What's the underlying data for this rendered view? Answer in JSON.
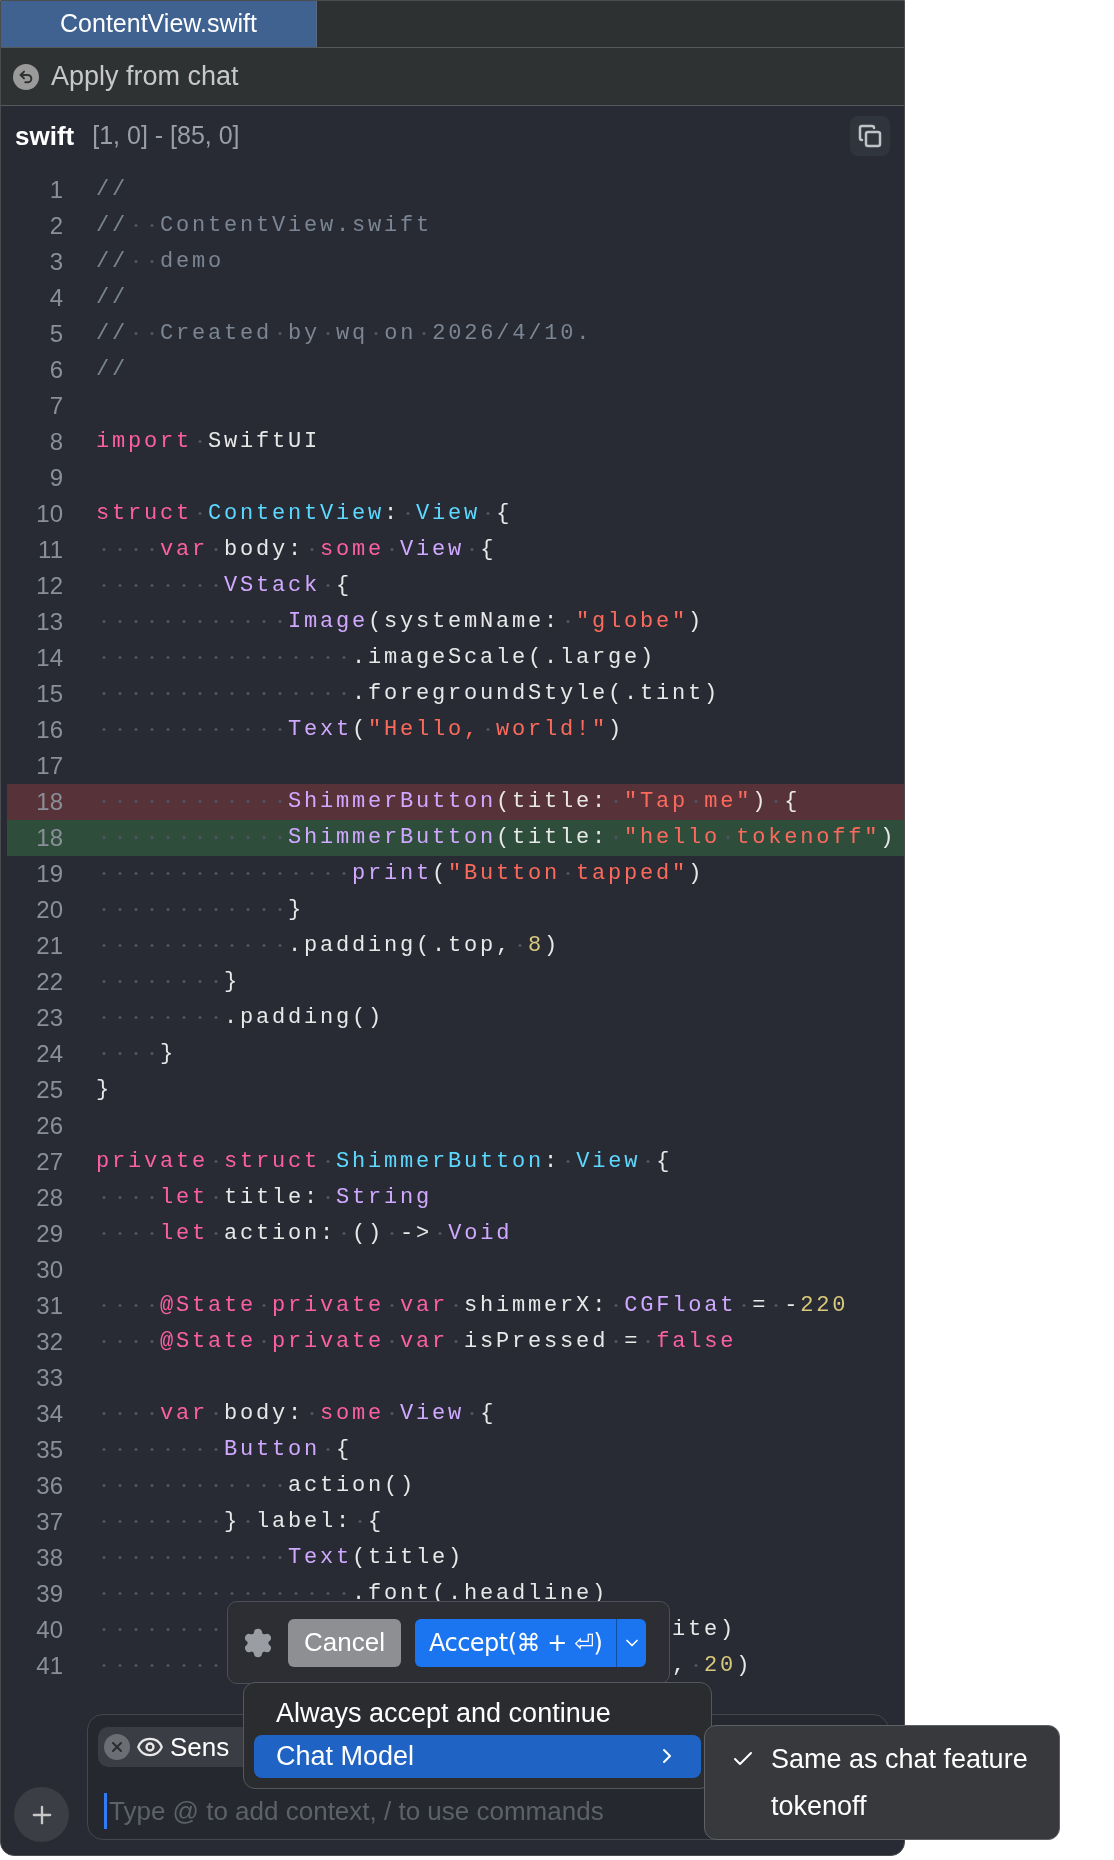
{
  "tabs": [
    {
      "label": "ContentView.swift",
      "selected": true
    }
  ],
  "apply_bar": {
    "label": "Apply from chat"
  },
  "code_header": {
    "language": "swift",
    "range": "[1, 0] - [85, 0]"
  },
  "lines": [
    {
      "number": "1",
      "kind": "context",
      "tokens": [
        {
          "kind": "comment",
          "text": "//"
        }
      ]
    },
    {
      "number": "2",
      "kind": "context",
      "tokens": [
        {
          "kind": "comment",
          "text": "//  ContentView.swift"
        }
      ]
    },
    {
      "number": "3",
      "kind": "context",
      "tokens": [
        {
          "kind": "comment",
          "text": "//  demo"
        }
      ]
    },
    {
      "number": "4",
      "kind": "context",
      "tokens": [
        {
          "kind": "comment",
          "text": "//"
        }
      ]
    },
    {
      "number": "5",
      "kind": "context",
      "tokens": [
        {
          "kind": "comment",
          "text": "//  Created by wq on 2026/4/10."
        }
      ]
    },
    {
      "number": "6",
      "kind": "context",
      "tokens": [
        {
          "kind": "comment",
          "text": "//"
        }
      ]
    },
    {
      "number": "7",
      "kind": "context"
    },
    {
      "number": "8",
      "kind": "context",
      "tokens": [
        {
          "kind": "keyword",
          "text": "import"
        },
        {
          "kind": "plain",
          "text": " SwiftUI"
        }
      ]
    },
    {
      "number": "9",
      "kind": "context"
    },
    {
      "number": "10",
      "kind": "context",
      "tokens": [
        {
          "kind": "keyword",
          "text": "struct"
        },
        {
          "kind": "type",
          "text": " ContentView"
        },
        {
          "kind": "plain",
          "text": ": "
        },
        {
          "kind": "type",
          "text": "View"
        },
        {
          "kind": "plain",
          "text": " {"
        }
      ]
    },
    {
      "number": "11",
      "kind": "context",
      "tokens": [
        {
          "kind": "keyword",
          "text": "    var"
        },
        {
          "kind": "plain",
          "text": " body: "
        },
        {
          "kind": "keyword",
          "text": "some"
        },
        {
          "kind": "call",
          "text": " View"
        },
        {
          "kind": "plain",
          "text": " {"
        }
      ]
    },
    {
      "number": "12",
      "kind": "context",
      "tokens": [
        {
          "kind": "call",
          "text": "        VStack"
        },
        {
          "kind": "plain",
          "text": " {"
        }
      ]
    },
    {
      "number": "13",
      "kind": "context",
      "tokens": [
        {
          "kind": "call",
          "text": "            Image"
        },
        {
          "kind": "plain",
          "text": "(systemName: "
        },
        {
          "kind": "string",
          "text": "\"globe\""
        },
        {
          "kind": "plain",
          "text": ")"
        }
      ]
    },
    {
      "number": "14",
      "kind": "context",
      "tokens": [
        {
          "kind": "plain",
          "text": "                .imageScale(.large)"
        }
      ]
    },
    {
      "number": "15",
      "kind": "context",
      "tokens": [
        {
          "kind": "plain",
          "text": "                .foregroundStyle(.tint)"
        }
      ]
    },
    {
      "number": "16",
      "kind": "context",
      "tokens": [
        {
          "kind": "call",
          "text": "            Text"
        },
        {
          "kind": "plain",
          "text": "("
        },
        {
          "kind": "string",
          "text": "\"Hello, world!\""
        },
        {
          "kind": "plain",
          "text": ")"
        }
      ]
    },
    {
      "number": "17",
      "kind": "context"
    },
    {
      "number": "18",
      "kind": "removed",
      "tokens": [
        {
          "kind": "call",
          "text": "            ShimmerButton"
        },
        {
          "kind": "plain",
          "text": "(title: "
        },
        {
          "kind": "string",
          "text": "\"Tap me\""
        },
        {
          "kind": "plain",
          "text": ") {"
        }
      ]
    },
    {
      "number": "18",
      "kind": "added",
      "tokens": [
        {
          "kind": "call",
          "text": "            ShimmerButton"
        },
        {
          "kind": "plain",
          "text": "(title: "
        },
        {
          "kind": "string",
          "text": "\"hello tokenoff\""
        },
        {
          "kind": "plain",
          "text": ")"
        }
      ]
    },
    {
      "number": "19",
      "kind": "context",
      "tokens": [
        {
          "kind": "call",
          "text": "                print"
        },
        {
          "kind": "plain",
          "text": "("
        },
        {
          "kind": "string",
          "text": "\"Button tapped\""
        },
        {
          "kind": "plain",
          "text": ")"
        }
      ]
    },
    {
      "number": "20",
      "kind": "context",
      "tokens": [
        {
          "kind": "plain",
          "text": "            }"
        }
      ]
    },
    {
      "number": "21",
      "kind": "context",
      "tokens": [
        {
          "kind": "plain",
          "text": "            .padding(.top, "
        },
        {
          "kind": "number",
          "text": "8"
        },
        {
          "kind": "plain",
          "text": ")"
        }
      ]
    },
    {
      "number": "22",
      "kind": "context",
      "tokens": [
        {
          "kind": "plain",
          "text": "        }"
        }
      ]
    },
    {
      "number": "23",
      "kind": "context",
      "tokens": [
        {
          "kind": "plain",
          "text": "        .padding()"
        }
      ]
    },
    {
      "number": "24",
      "kind": "context",
      "tokens": [
        {
          "kind": "plain",
          "text": "    }"
        }
      ]
    },
    {
      "number": "25",
      "kind": "context",
      "tokens": [
        {
          "kind": "plain",
          "text": "}"
        }
      ]
    },
    {
      "number": "26",
      "kind": "context"
    },
    {
      "number": "27",
      "kind": "context",
      "tokens": [
        {
          "kind": "keyword",
          "text": "private struct"
        },
        {
          "kind": "type",
          "text": " ShimmerButton"
        },
        {
          "kind": "plain",
          "text": ": "
        },
        {
          "kind": "type",
          "text": "View"
        },
        {
          "kind": "plain",
          "text": " {"
        }
      ]
    },
    {
      "number": "28",
      "kind": "context",
      "tokens": [
        {
          "kind": "keyword",
          "text": "    let"
        },
        {
          "kind": "plain",
          "text": " title: "
        },
        {
          "kind": "call",
          "text": "String"
        }
      ]
    },
    {
      "number": "29",
      "kind": "context",
      "tokens": [
        {
          "kind": "keyword",
          "text": "    let"
        },
        {
          "kind": "plain",
          "text": " action: () -> "
        },
        {
          "kind": "call",
          "text": "Void"
        }
      ]
    },
    {
      "number": "30",
      "kind": "context"
    },
    {
      "number": "31",
      "kind": "context",
      "tokens": [
        {
          "kind": "keyword",
          "text": "    @State private var"
        },
        {
          "kind": "plain",
          "text": " shimmerX: "
        },
        {
          "kind": "call",
          "text": "CGFloat"
        },
        {
          "kind": "plain",
          "text": " = -"
        },
        {
          "kind": "number",
          "text": "220"
        }
      ]
    },
    {
      "number": "32",
      "kind": "context",
      "tokens": [
        {
          "kind": "keyword",
          "text": "    @State private var"
        },
        {
          "kind": "plain",
          "text": " isPressed = "
        },
        {
          "kind": "keyword",
          "text": "false"
        }
      ]
    },
    {
      "number": "33",
      "kind": "context"
    },
    {
      "number": "34",
      "kind": "context",
      "tokens": [
        {
          "kind": "keyword",
          "text": "    var"
        },
        {
          "kind": "plain",
          "text": " body: "
        },
        {
          "kind": "keyword",
          "text": "some"
        },
        {
          "kind": "call",
          "text": " View"
        },
        {
          "kind": "plain",
          "text": " {"
        }
      ]
    },
    {
      "number": "35",
      "kind": "context",
      "tokens": [
        {
          "kind": "call",
          "text": "        Button"
        },
        {
          "kind": "plain",
          "text": " {"
        }
      ]
    },
    {
      "number": "36",
      "kind": "context",
      "tokens": [
        {
          "kind": "plain",
          "text": "            action()"
        }
      ]
    },
    {
      "number": "37",
      "kind": "context",
      "tokens": [
        {
          "kind": "plain",
          "text": "        } label: {"
        }
      ]
    },
    {
      "number": "38",
      "kind": "context",
      "tokens": [
        {
          "kind": "call",
          "text": "            Text"
        },
        {
          "kind": "plain",
          "text": "(title)"
        }
      ]
    },
    {
      "number": "39",
      "kind": "context",
      "tokens": [
        {
          "kind": "plain",
          "text": "                .font(.headline)"
        }
      ]
    },
    {
      "number": "40",
      "kind": "context",
      "tokens": [
        {
          "kind": "plain",
          "text": "                                    ite)"
        }
      ]
    },
    {
      "number": "41",
      "kind": "context",
      "tokens": [
        {
          "kind": "plain",
          "text": "                                    , "
        },
        {
          "kind": "number",
          "text": "20"
        },
        {
          "kind": "plain",
          "text": ")"
        }
      ]
    }
  ],
  "action_bar": {
    "cancel": "Cancel",
    "accept": "Accept(⌘ + ⏎)"
  },
  "menu": {
    "items": [
      {
        "label": "Always accept and continue",
        "selected": false,
        "submenu": false
      },
      {
        "label": "Chat Model",
        "selected": true,
        "submenu": true
      }
    ]
  },
  "submenu": {
    "items": [
      {
        "label": "Same as chat feature",
        "checked": true
      },
      {
        "label": "tokenoff",
        "checked": false
      }
    ]
  },
  "chat": {
    "chip": "Sens",
    "placeholder": "Type @ to add context, / to use commands"
  }
}
